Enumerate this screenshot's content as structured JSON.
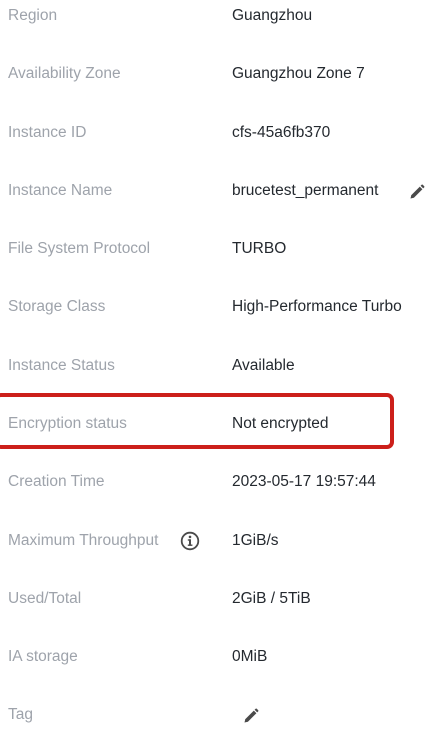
{
  "details": {
    "region": {
      "label": "Region",
      "value": "Guangzhou"
    },
    "availability_zone": {
      "label": "Availability Zone",
      "value": "Guangzhou Zone 7"
    },
    "instance_id": {
      "label": "Instance ID",
      "value": "cfs-45a6fb370"
    },
    "instance_name": {
      "label": "Instance Name",
      "value": "brucetest_permanent"
    },
    "protocol": {
      "label": "File System Protocol",
      "value": "TURBO"
    },
    "storage_class": {
      "label": "Storage Class",
      "value": "High-Performance Turbo"
    },
    "status": {
      "label": "Instance Status",
      "value": "Available"
    },
    "encryption": {
      "label": "Encryption status",
      "value": "Not encrypted"
    },
    "creation_time": {
      "label": "Creation Time",
      "value": "2023-05-17 19:57:44"
    },
    "max_throughput": {
      "label": "Maximum Throughput",
      "value": "1GiB/s"
    },
    "used_total": {
      "label": "Used/Total",
      "value": "2GiB / 5TiB"
    },
    "ia_storage": {
      "label": "IA storage",
      "value": "0MiB"
    },
    "tag": {
      "label": "Tag"
    }
  },
  "icons": {
    "edit": "pencil-icon",
    "info": "info-circle-icon"
  },
  "colors": {
    "label": "#9ea3ab",
    "value": "#24292f",
    "highlight": "#cc1f1a",
    "icon": "#4a4a4a"
  }
}
